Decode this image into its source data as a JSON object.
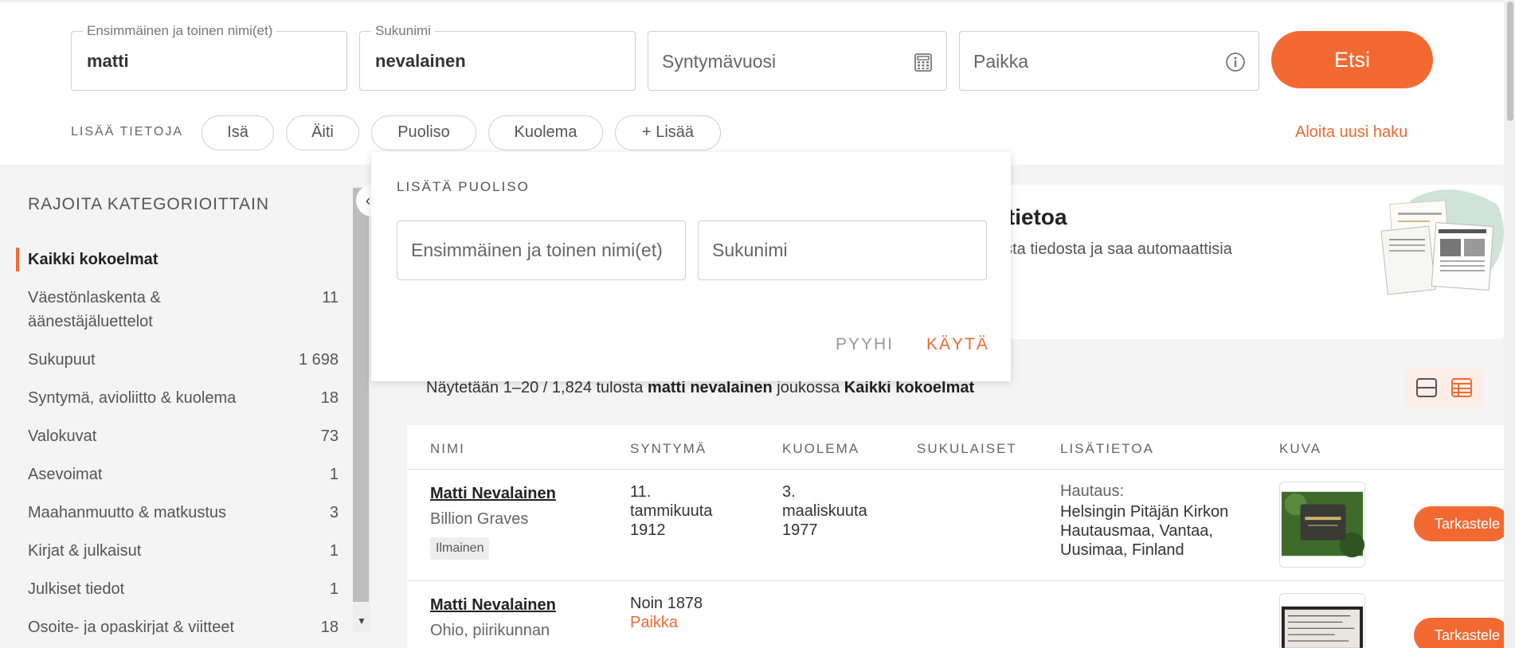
{
  "search": {
    "first_name_legend": "Ensimmäinen ja toinen nimi(et)",
    "first_name_value": "matti",
    "last_name_legend": "Sukunimi",
    "last_name_value": "nevalainen",
    "birth_year_placeholder": "Syntymävuosi",
    "place_placeholder": "Paikka",
    "submit_label": "Etsi",
    "more_info_label": "LISÄÄ TIETOJA",
    "chips": [
      "Isä",
      "Äiti",
      "Puoliso",
      "Kuolema",
      "+ Lisää"
    ],
    "new_search_label": "Aloita uusi haku"
  },
  "sidebar": {
    "title": "RAJOITA KATEGORIOITTAIN",
    "categories": [
      {
        "label": "Kaikki kokoelmat",
        "count": ""
      },
      {
        "label": "Väestönlaskenta & äänestäjäluettelot",
        "count": "11"
      },
      {
        "label": "Sukupuut",
        "count": "1 698"
      },
      {
        "label": "Syntymä, avioliitto & kuolema",
        "count": "18"
      },
      {
        "label": "Valokuvat",
        "count": "73"
      },
      {
        "label": "Asevoimat",
        "count": "1"
      },
      {
        "label": "Maahanmuutto & matkustus",
        "count": "3"
      },
      {
        "label": "Kirjat & julkaisut",
        "count": "1"
      },
      {
        "label": "Julkiset tiedot",
        "count": "1"
      },
      {
        "label": "Osoite- ja opaskirjat & viitteet",
        "count": "18"
      }
    ]
  },
  "popup": {
    "title": "LISÄTÄ PUOLISO",
    "first_name_placeholder": "Ensimmäinen ja toinen nimi(et)",
    "last_name_placeholder": "Sukunimi",
    "clear_label": "PYYHI",
    "apply_label": "KÄYTÄ"
  },
  "promo": {
    "heading": "n tietoa",
    "text": "sesta tiedosta ja saa automaattisia"
  },
  "results": {
    "prefix": "Näytetään 1–20 / 1,824 tulosta",
    "query": "matti nevalainen",
    "middle": "joukossa",
    "collection": "Kaikki kokoelmat"
  },
  "table": {
    "headers": [
      "NIMI",
      "SYNTYMÄ",
      "KUOLEMA",
      "SUKULAISET",
      "LISÄTIETOA",
      "KUVA"
    ],
    "rows": [
      {
        "name": "Matti Nevalainen",
        "source": "Billion Graves",
        "badge": "Ilmainen",
        "birth": [
          "11.",
          "tammikuuta",
          "1912"
        ],
        "death": [
          "3.",
          "maaliskuuta",
          "1977"
        ],
        "info_label": "Hautaus:",
        "info_value": [
          "Helsingin Pitäjän Kirkon",
          "Hautausmaa, Vantaa,",
          "Uusimaa, Finland"
        ],
        "action": "Tarkastele"
      },
      {
        "name": "Matti Nevalainen",
        "source": "Ohio, piirikunnan",
        "birth": [
          "Noin 1878"
        ],
        "birth_place": "Paikka",
        "action": "Tarkastele"
      }
    ]
  },
  "colors": {
    "accent": "#f26a32",
    "link_orange": "#ee6a32"
  }
}
